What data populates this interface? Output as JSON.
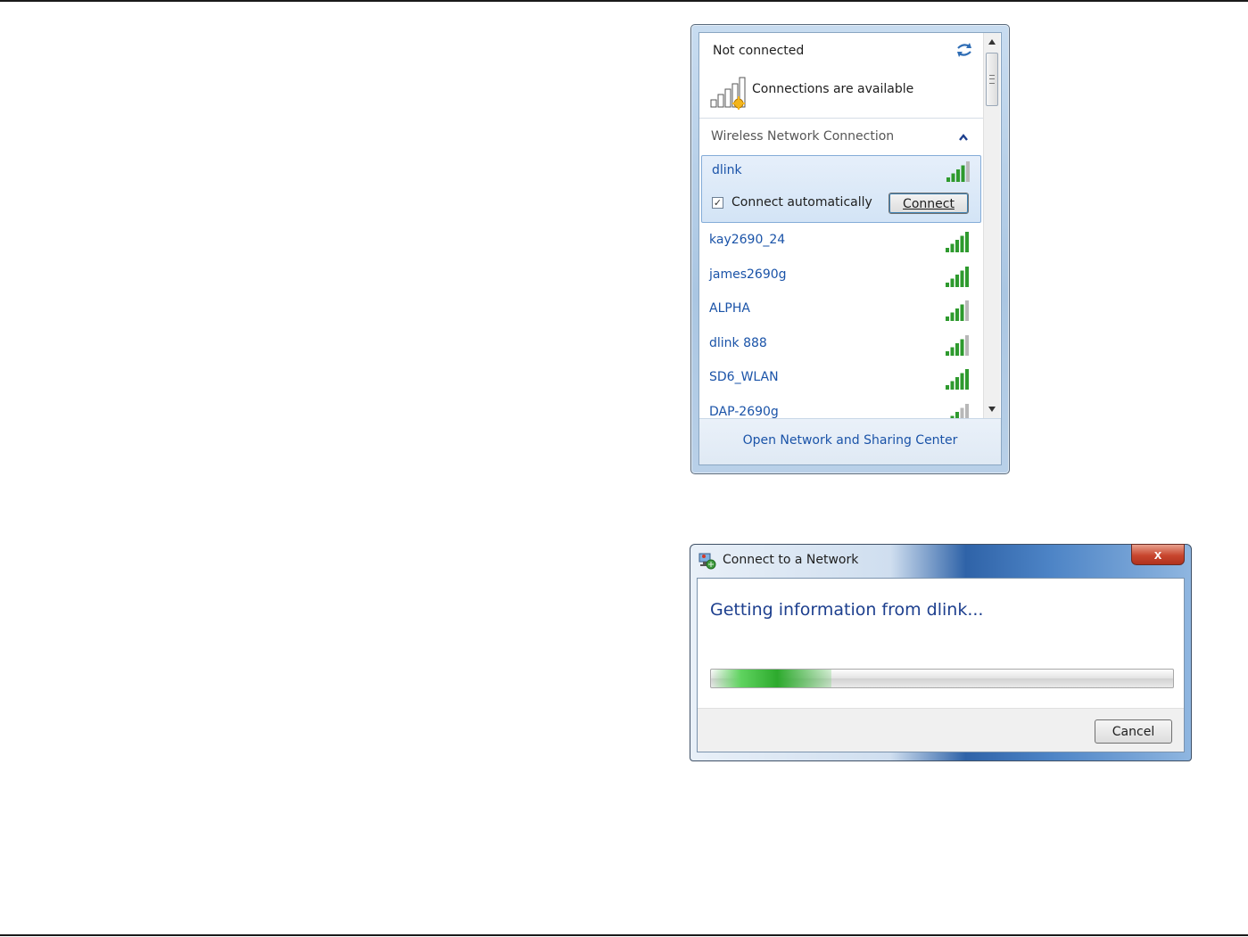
{
  "flyout": {
    "status_title": "Not connected",
    "status_subtitle": "Connections are available",
    "section_title": "Wireless Network Connection",
    "selected_network": {
      "name": "dlink",
      "auto_connect_label": "Connect automatically",
      "auto_connect_checked": true,
      "connect_label": "Connect"
    },
    "networks": [
      {
        "name": "kay2690_24",
        "signal_bars": 5
      },
      {
        "name": "james2690g",
        "signal_bars": 5
      },
      {
        "name": "ALPHA",
        "signal_bars": 4
      },
      {
        "name": "dlink 888",
        "signal_bars": 4
      },
      {
        "name": "SD6_WLAN",
        "signal_bars": 5
      },
      {
        "name": "DAP-2690g",
        "signal_bars": 3
      }
    ],
    "footer_link": "Open Network and Sharing Center"
  },
  "dialog": {
    "title": "Connect to a Network",
    "close_label": "x",
    "message": "Getting information from dlink...",
    "progress_fraction": 0.26,
    "cancel_label": "Cancel"
  },
  "colors": {
    "link_blue": "#1a53a8",
    "signal_green": "#2e9a2e",
    "signal_gray": "#b8b8b8",
    "heading_blue": "#1d3f8e"
  }
}
